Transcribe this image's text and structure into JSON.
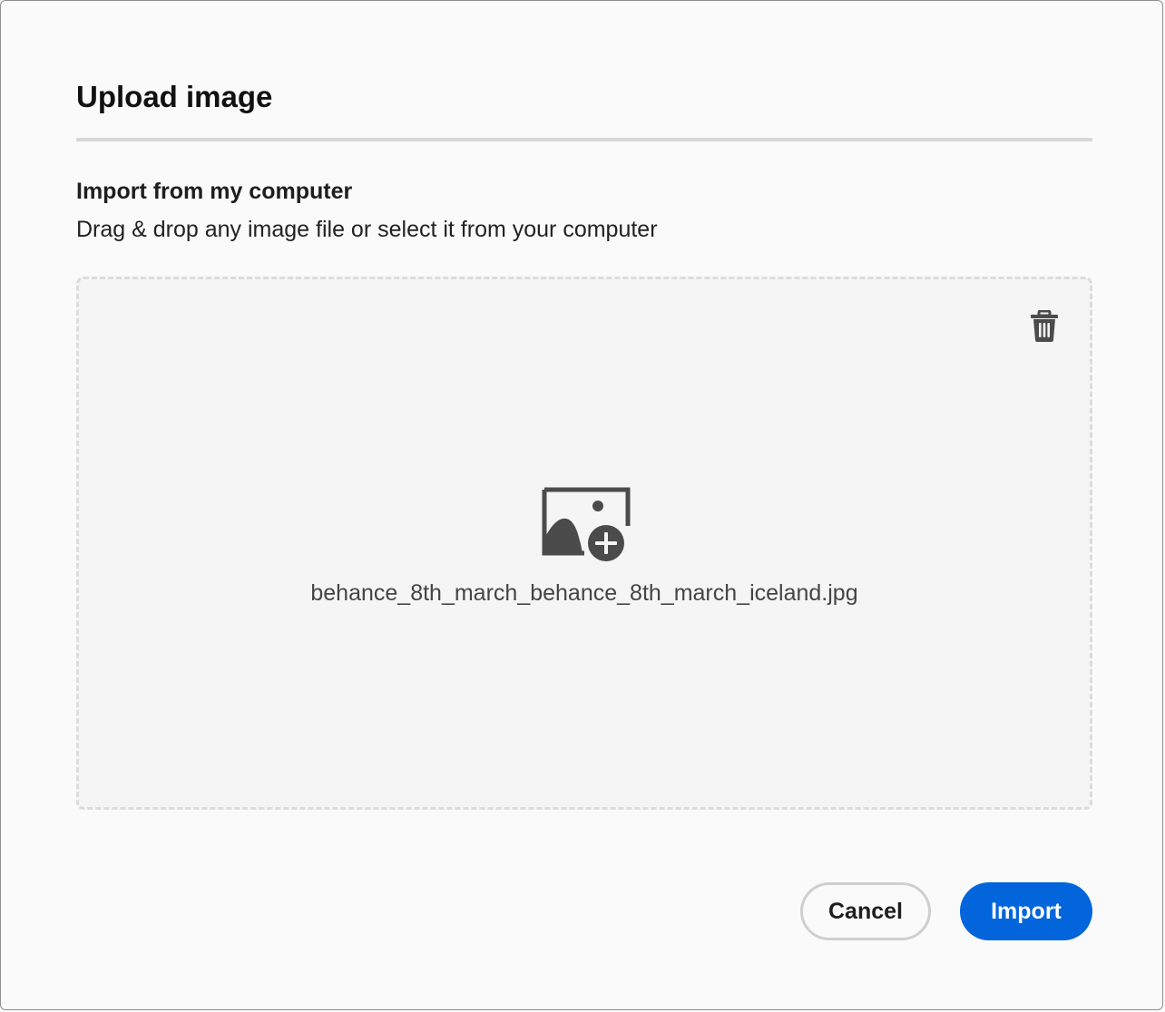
{
  "dialog": {
    "title": "Upload image"
  },
  "import_section": {
    "heading": "Import from my computer",
    "description": "Drag & drop any image file or select it from your computer"
  },
  "dropzone": {
    "file_name": "behance_8th_march_behance_8th_march_iceland.jpg",
    "file_icon": "image-add-icon",
    "delete_icon": "trash-icon"
  },
  "actions": {
    "cancel_label": "Cancel",
    "import_label": "Import"
  },
  "colors": {
    "primary": "#0265dc",
    "icon": "#4b4b4b",
    "divider": "#d8d8d8"
  }
}
